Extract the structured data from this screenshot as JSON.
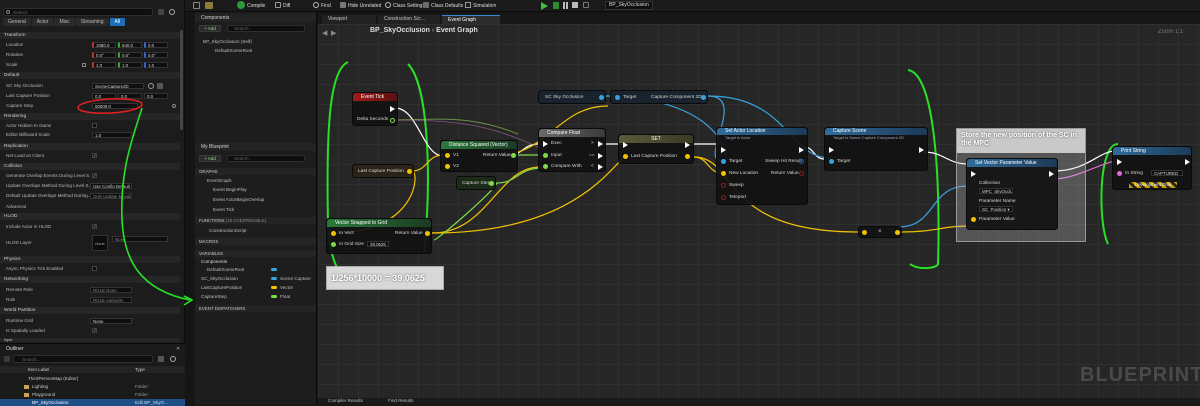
{
  "toolbar": {
    "compile": "Compile",
    "diff": "Diff",
    "find": "Find",
    "hide_unrelated": "Hide Unrelated",
    "class_settings": "Class Settings",
    "class_defaults": "Class Defaults",
    "simulation": "Simulation",
    "debug_target": "BP_SkyOcclusion"
  },
  "details": {
    "search_placeholder": "Search",
    "tabs": [
      "General",
      "Actor",
      "Misc",
      "Streaming",
      "All"
    ],
    "transform": {
      "title": "Transform",
      "location_label": "Location",
      "location": [
        "1080.0",
        "840.0",
        "0.0"
      ],
      "rotation_label": "Rotation",
      "rotation": [
        "0.0°",
        "0.0°",
        "0.0°"
      ],
      "scale_label": "Scale",
      "scale": [
        "1.0",
        "1.0",
        "1.0"
      ]
    },
    "default": {
      "title": "Default",
      "sc_label": "SC Sky Occlusion",
      "sc_value": "SceneCapture2D",
      "lcp_label": "Last Capture Position",
      "lcp": [
        "0.0",
        "0.0",
        "0.0"
      ],
      "cs_label": "Capture Step",
      "cs_value": "50000.0"
    },
    "rendering": {
      "title": "Rendering",
      "hidden_label": "Actor Hidden In Game",
      "billboard_label": "Editor Billboard Scale",
      "billboard_value": "1.0"
    },
    "replication": {
      "title": "Replication",
      "net_load_label": "Net Load on Client"
    },
    "collision": {
      "title": "Collision",
      "gen_overlap_label": "Generate Overlap Events During Level S...",
      "update_overlap_label": "Update Overlaps Method During Level S...",
      "update_overlap_value": "Use Config Default",
      "default_update_label": "Default Update Overlaps Method During...",
      "default_update_value": "Only Update Movable"
    },
    "advanced": "Advanced",
    "hlod": {
      "title": "HLOD",
      "include_label": "Include Actor in HLOD",
      "layer_label": "HLOD Layer",
      "layer_value": "None",
      "layer_thumb": "None"
    },
    "physics": {
      "title": "Physics",
      "async_label": "Async Physics Tick Enabled"
    },
    "networking": {
      "title": "Networking",
      "remote_label": "Remote Role",
      "remote_value": "ROLE None",
      "role_label": "Role",
      "role_value": "ROLE Authority"
    },
    "world_partition": {
      "title": "World Partition",
      "grid_label": "Runtime Grid",
      "grid_value": "None",
      "spatial_label": "Is Spatially Loaded"
    },
    "input": "Input"
  },
  "outliner": {
    "title": "Outliner",
    "search_placeholder": "Search...",
    "col_label": "Item Label",
    "col_type": "Type",
    "rows": [
      {
        "label": "ThirdPersonMap (Editor)",
        "type": ""
      },
      {
        "label": "Lighting",
        "type": "Folder"
      },
      {
        "label": "Playground",
        "type": "Folder"
      },
      {
        "label": "BP_SkyOcclusion",
        "type": "Edit BP_SkyO..."
      }
    ]
  },
  "components": {
    "title": "Components",
    "add": "+ Add",
    "search_placeholder": "Search",
    "root": "BP_SkyOcclusion (Self)",
    "child": "DefaultSceneRoot"
  },
  "myblueprint": {
    "title": "My Blueprint",
    "add": "+ Add",
    "search_placeholder": "Search",
    "graphs_title": "GRAPHS",
    "graphs": [
      "EventGraph",
      "Event BeginPlay",
      "Event ActorBeginOverlap",
      "Event Tick"
    ],
    "functions_title": "FUNCTIONS",
    "functions_hint": "(20 OVERRIDABLE)",
    "functions": [
      "ConstructionScript"
    ],
    "macros_title": "MACROS",
    "variables_title": "VARIABLES",
    "var_group": "Components",
    "variables": [
      {
        "name": "DefaultSceneRoot",
        "type": ""
      },
      {
        "name": "SC_SkyOcclusion",
        "type": "Scene Capture"
      },
      {
        "name": "LastCapturePosition",
        "type": "Vector"
      },
      {
        "name": "CaptureStep",
        "type": "Float"
      }
    ],
    "dispatchers_title": "EVENT DISPATCHERS"
  },
  "tabs": {
    "viewport": "Viewport",
    "construction": "Construction Scr...",
    "event_graph": "Event Graph"
  },
  "graph": {
    "breadcrumb_root": "BP_SkyOcclusion",
    "breadcrumb_sep": "›",
    "breadcrumb_leaf": "Event Graph",
    "zoom": "Zoom 1:1",
    "watermark": "BLUEPRINT",
    "nodes": {
      "event_tick": {
        "title": "Event Tick",
        "pin": "Delta Seconds"
      },
      "last_capture": {
        "title": "Last Capture Position"
      },
      "capture_step": {
        "title": "Capture Step"
      },
      "dist": {
        "title": "Distance Squared (Vector)",
        "v1": "V1",
        "v2": "V2",
        "ret": "Return Value"
      },
      "compare": {
        "title": "Compare Float",
        "exec": "Exec",
        "input": "Input",
        "compare": "Compare With",
        "gt": ">",
        "eq": "==",
        "lt": "<"
      },
      "set": {
        "title": "SET",
        "pin": "Last Capture Position"
      },
      "sc_ref": {
        "title": "SC Sky Occlusion"
      },
      "target_get": {
        "target": "Target",
        "out": "Capture Component 2D"
      },
      "set_loc": {
        "title": "Set Actor Location",
        "sub": "Target is Actor",
        "target": "Target",
        "new_loc": "New Location",
        "sweep": "Sweep",
        "teleport": "Teleport",
        "hit": "Sweep Hit Result",
        "ret": "Return Value"
      },
      "cap_scene": {
        "title": "Capture Scene",
        "sub": "Target is Scene Capture Component 2D",
        "target": "Target"
      },
      "snap": {
        "title": "Vector Snapped to Grid",
        "vect": "In Vect",
        "grid": "In Grid Size",
        "grid_val": "39.0625",
        "ret": "Return Value"
      },
      "comment_formula": "1/256*10000 = 39.0625",
      "mult": {
        "sym": "×"
      },
      "comment_store": "Store the new position of  the SC in the MPC",
      "set_vec": {
        "title": "Set Vector Parameter Value",
        "collection": "Collection",
        "collection_val": "MPC_SkyOcclu ▾",
        "pname": "Parameter Name",
        "pname_val": "SC_Position ▾",
        "pval": "Parameter Value"
      },
      "print": {
        "title": "Print String",
        "instring": "In String",
        "instring_val": "CAPTURED",
        "dev": "Development Only"
      }
    }
  },
  "bottom": {
    "compiler": "Compiler Results",
    "find": "Find Results"
  }
}
